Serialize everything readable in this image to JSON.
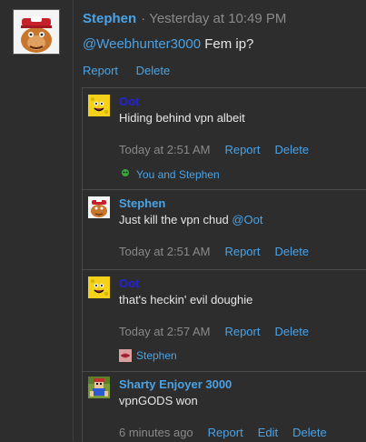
{
  "main_post": {
    "author": "Stephen",
    "separator": "·",
    "timestamp": "Yesterday at 10:49 PM",
    "mention": "@Weebhunter3000",
    "text": "Fem ip?",
    "actions": [
      "Report",
      "Delete"
    ],
    "avatar_icon": "cartoon-ape-avatar"
  },
  "replies": [
    {
      "author": "Oot",
      "author_color": "#2222dd",
      "avatar_icon": "yellow-cheese-face-avatar",
      "text": "Hiding behind vpn albeit",
      "mention": "",
      "time": "Today at 2:51 AM",
      "actions": [
        "Report",
        "Delete"
      ],
      "reaction_icon": "green-goblin-icon",
      "reaction_text": "You and Stephen"
    },
    {
      "author": "Stephen",
      "author_color": "#4aa3e6",
      "avatar_icon": "cartoon-ape-avatar",
      "text": "Just kill the vpn chud",
      "mention": "@Oot",
      "time": "Today at 2:51 AM",
      "actions": [
        "Report",
        "Delete"
      ]
    },
    {
      "author": "Oot",
      "author_color": "#2222dd",
      "avatar_icon": "yellow-cheese-face-avatar",
      "text": "that's heckin' evil doughie",
      "mention": "",
      "time": "Today at 2:57 AM",
      "actions": [
        "Report",
        "Delete"
      ],
      "reaction_icon": "lips-icon",
      "reaction_text": "Stephen"
    },
    {
      "author": "Sharty Enjoyer 3000",
      "author_color": "#4aa3e6",
      "avatar_icon": "pixel-character-avatar",
      "text": "vpnGODS won",
      "mention": "",
      "time": "6 minutes ago",
      "actions": [
        "Report",
        "Edit",
        "Delete"
      ]
    }
  ],
  "colors": {
    "background": "#2d2d2d",
    "link": "#4aa3e6",
    "muted": "#8a8a8a",
    "text": "#e6e6e6"
  }
}
